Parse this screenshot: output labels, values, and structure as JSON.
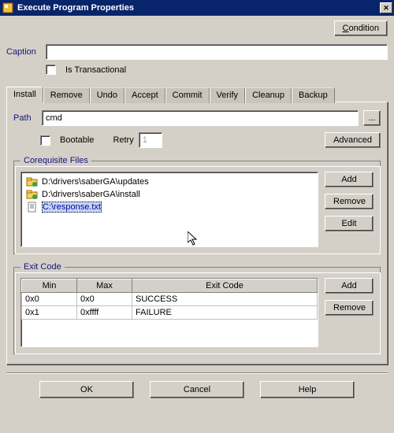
{
  "window": {
    "title": "Execute Program Properties"
  },
  "buttons": {
    "condition": "Condition",
    "advanced": "Advanced",
    "add": "Add",
    "remove": "Remove",
    "edit": "Edit",
    "ok": "OK",
    "cancel": "Cancel",
    "help": "Help",
    "browse": "..."
  },
  "labels": {
    "caption": "Caption",
    "is_transactional": "Is Transactional",
    "path": "Path",
    "bootable": "Bootable",
    "retry": "Retry",
    "corequisite": "Corequisite Files",
    "exit_code": "Exit Code"
  },
  "fields": {
    "caption_value": "",
    "path_value": "cmd",
    "retry_value": "1"
  },
  "tabs": [
    "Install",
    "Remove",
    "Undo",
    "Accept",
    "Commit",
    "Verify",
    "Cleanup",
    "Backup"
  ],
  "active_tab": 0,
  "files": [
    {
      "name": "D:\\drivers\\saberGA\\updates",
      "type": "folder",
      "selected": false
    },
    {
      "name": "D:\\drivers\\saberGA\\install",
      "type": "folder",
      "selected": false
    },
    {
      "name": "C:\\response.txt",
      "type": "doc",
      "selected": true
    }
  ],
  "exit_code_table": {
    "headers": [
      "Min",
      "Max",
      "Exit Code"
    ],
    "rows": [
      {
        "min": "0x0",
        "max": "0x0",
        "code": "SUCCESS"
      },
      {
        "min": "0x1",
        "max": "0xffff",
        "code": "FAILURE"
      }
    ]
  }
}
